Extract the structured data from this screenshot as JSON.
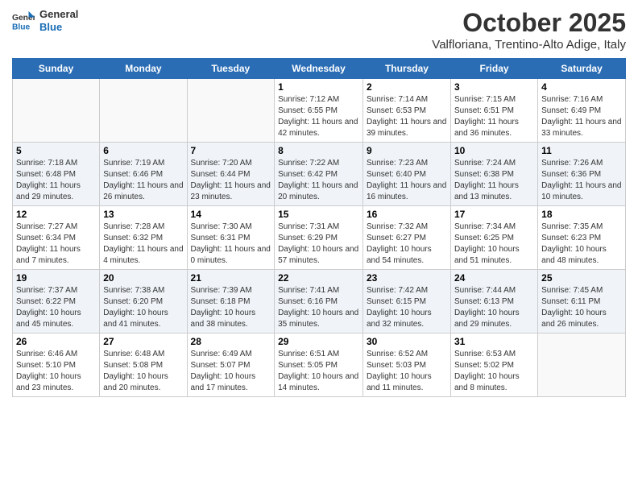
{
  "logo": {
    "line1": "General",
    "line2": "Blue"
  },
  "title": "October 2025",
  "subtitle": "Valfloriana, Trentino-Alto Adige, Italy",
  "days": [
    "Sunday",
    "Monday",
    "Tuesday",
    "Wednesday",
    "Thursday",
    "Friday",
    "Saturday"
  ],
  "weeks": [
    [
      {
        "day": "",
        "text": ""
      },
      {
        "day": "",
        "text": ""
      },
      {
        "day": "",
        "text": ""
      },
      {
        "day": "1",
        "text": "Sunrise: 7:12 AM\nSunset: 6:55 PM\nDaylight: 11 hours and 42 minutes."
      },
      {
        "day": "2",
        "text": "Sunrise: 7:14 AM\nSunset: 6:53 PM\nDaylight: 11 hours and 39 minutes."
      },
      {
        "day": "3",
        "text": "Sunrise: 7:15 AM\nSunset: 6:51 PM\nDaylight: 11 hours and 36 minutes."
      },
      {
        "day": "4",
        "text": "Sunrise: 7:16 AM\nSunset: 6:49 PM\nDaylight: 11 hours and 33 minutes."
      }
    ],
    [
      {
        "day": "5",
        "text": "Sunrise: 7:18 AM\nSunset: 6:48 PM\nDaylight: 11 hours and 29 minutes."
      },
      {
        "day": "6",
        "text": "Sunrise: 7:19 AM\nSunset: 6:46 PM\nDaylight: 11 hours and 26 minutes."
      },
      {
        "day": "7",
        "text": "Sunrise: 7:20 AM\nSunset: 6:44 PM\nDaylight: 11 hours and 23 minutes."
      },
      {
        "day": "8",
        "text": "Sunrise: 7:22 AM\nSunset: 6:42 PM\nDaylight: 11 hours and 20 minutes."
      },
      {
        "day": "9",
        "text": "Sunrise: 7:23 AM\nSunset: 6:40 PM\nDaylight: 11 hours and 16 minutes."
      },
      {
        "day": "10",
        "text": "Sunrise: 7:24 AM\nSunset: 6:38 PM\nDaylight: 11 hours and 13 minutes."
      },
      {
        "day": "11",
        "text": "Sunrise: 7:26 AM\nSunset: 6:36 PM\nDaylight: 11 hours and 10 minutes."
      }
    ],
    [
      {
        "day": "12",
        "text": "Sunrise: 7:27 AM\nSunset: 6:34 PM\nDaylight: 11 hours and 7 minutes."
      },
      {
        "day": "13",
        "text": "Sunrise: 7:28 AM\nSunset: 6:32 PM\nDaylight: 11 hours and 4 minutes."
      },
      {
        "day": "14",
        "text": "Sunrise: 7:30 AM\nSunset: 6:31 PM\nDaylight: 11 hours and 0 minutes."
      },
      {
        "day": "15",
        "text": "Sunrise: 7:31 AM\nSunset: 6:29 PM\nDaylight: 10 hours and 57 minutes."
      },
      {
        "day": "16",
        "text": "Sunrise: 7:32 AM\nSunset: 6:27 PM\nDaylight: 10 hours and 54 minutes."
      },
      {
        "day": "17",
        "text": "Sunrise: 7:34 AM\nSunset: 6:25 PM\nDaylight: 10 hours and 51 minutes."
      },
      {
        "day": "18",
        "text": "Sunrise: 7:35 AM\nSunset: 6:23 PM\nDaylight: 10 hours and 48 minutes."
      }
    ],
    [
      {
        "day": "19",
        "text": "Sunrise: 7:37 AM\nSunset: 6:22 PM\nDaylight: 10 hours and 45 minutes."
      },
      {
        "day": "20",
        "text": "Sunrise: 7:38 AM\nSunset: 6:20 PM\nDaylight: 10 hours and 41 minutes."
      },
      {
        "day": "21",
        "text": "Sunrise: 7:39 AM\nSunset: 6:18 PM\nDaylight: 10 hours and 38 minutes."
      },
      {
        "day": "22",
        "text": "Sunrise: 7:41 AM\nSunset: 6:16 PM\nDaylight: 10 hours and 35 minutes."
      },
      {
        "day": "23",
        "text": "Sunrise: 7:42 AM\nSunset: 6:15 PM\nDaylight: 10 hours and 32 minutes."
      },
      {
        "day": "24",
        "text": "Sunrise: 7:44 AM\nSunset: 6:13 PM\nDaylight: 10 hours and 29 minutes."
      },
      {
        "day": "25",
        "text": "Sunrise: 7:45 AM\nSunset: 6:11 PM\nDaylight: 10 hours and 26 minutes."
      }
    ],
    [
      {
        "day": "26",
        "text": "Sunrise: 6:46 AM\nSunset: 5:10 PM\nDaylight: 10 hours and 23 minutes."
      },
      {
        "day": "27",
        "text": "Sunrise: 6:48 AM\nSunset: 5:08 PM\nDaylight: 10 hours and 20 minutes."
      },
      {
        "day": "28",
        "text": "Sunrise: 6:49 AM\nSunset: 5:07 PM\nDaylight: 10 hours and 17 minutes."
      },
      {
        "day": "29",
        "text": "Sunrise: 6:51 AM\nSunset: 5:05 PM\nDaylight: 10 hours and 14 minutes."
      },
      {
        "day": "30",
        "text": "Sunrise: 6:52 AM\nSunset: 5:03 PM\nDaylight: 10 hours and 11 minutes."
      },
      {
        "day": "31",
        "text": "Sunrise: 6:53 AM\nSunset: 5:02 PM\nDaylight: 10 hours and 8 minutes."
      },
      {
        "day": "",
        "text": ""
      }
    ]
  ]
}
